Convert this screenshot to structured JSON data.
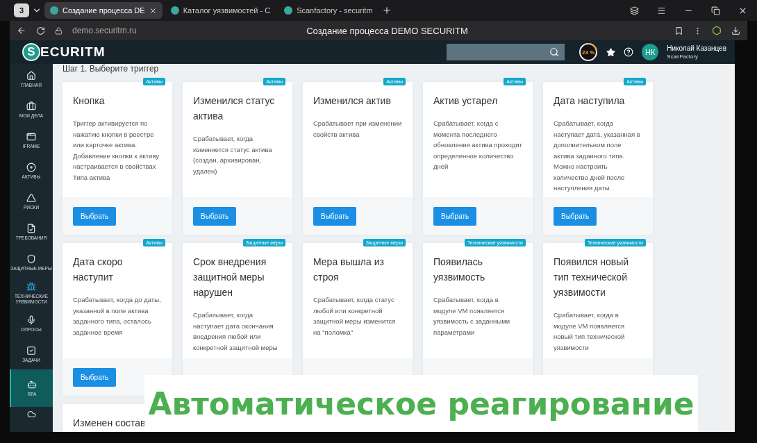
{
  "browser": {
    "tab_count": "3",
    "tabs": [
      {
        "title": "Создание процесса DE",
        "selected": true
      },
      {
        "title": "Каталог уязвимостей - C",
        "selected": false
      },
      {
        "title": "Scanfactory - securitm",
        "selected": false
      }
    ],
    "url": "demo.securitm.ru",
    "page_title": "Создание процесса DEMO SECURITM"
  },
  "header": {
    "logo_mark": "S",
    "logo_text": "ECURITM",
    "progress": {
      "label": "23 %",
      "level": 0.23
    },
    "avatar": "НК",
    "user_name": "Николай Казанцев",
    "org": "ScanFactory"
  },
  "sidebar": {
    "items": [
      {
        "label": "ГЛАВНАЯ",
        "selected": false
      },
      {
        "label": "МОИ ДЕЛА",
        "selected": false
      },
      {
        "label": "IFRAME",
        "selected": false
      },
      {
        "label": "АКТИВЫ",
        "selected": false
      },
      {
        "label": "РИСКИ",
        "selected": false
      },
      {
        "label": "ТРЕБОВАНИЯ",
        "selected": false
      },
      {
        "label": "ЗАЩИТНЫЕ МЕРЫ",
        "selected": false
      },
      {
        "label": "ТЕХНИЧЕСКИЕ УЯЗВИМОСТИ",
        "selected": false
      },
      {
        "label": "ОПРОСЫ",
        "selected": false
      },
      {
        "label": "ЗАДАЧИ",
        "selected": false
      },
      {
        "label": "RPA",
        "selected": true
      }
    ]
  },
  "heading": "Шаг 1. Выберите триггер",
  "cards": [
    {
      "badge": "Активы",
      "title": "Кнопка",
      "description": "Триггер активируется по нажатию кнопки в реестре или карточке актива. Добавление кнопки к активу настраивается в свойствах Типа актива",
      "button": "Выбрать"
    },
    {
      "badge": "Активы",
      "title": "Изменился статус актива",
      "description": "Срабатывает, когда изменяется статус актива (создан, архивирован, удален)",
      "button": "Выбрать"
    },
    {
      "badge": "Активы",
      "title": "Изменился актив",
      "description": "Срабатывает при изменении свойств актива",
      "button": "Выбрать"
    },
    {
      "badge": "Активы",
      "title": "Актив устарел",
      "description": "Срабатывает, когда с момента последнего обновления актива проходит определенное количество дней",
      "button": "Выбрать"
    },
    {
      "badge": "Активы",
      "title": "Дата наступила",
      "description": "Срабатывает, когда наступает дата, указанная в дополнительном поле актива заданного типа. Можно настроить количество дней после наступления даты.",
      "button": "Выбрать"
    },
    {
      "badge": "Активы",
      "title": "Дата скоро наступит",
      "description": "Срабатывает, когда до даты, указанной в поле актива заданного типа, осталось заданное время",
      "button": "Выбрать"
    },
    {
      "badge": "Защитные меры",
      "title": "Срок внедрения защитной меры нарушен",
      "description": "Срабатывает, когда наступает дата окончания внедрения любой или конкретной защитной меры"
    },
    {
      "badge": "Защитные меры",
      "title": "Мера вышла из строя",
      "description": "Срабатывает, когда статус любой или конкретной защитной меры изменится на \"поломка\""
    },
    {
      "badge": "Технические уязвимости",
      "title": "Появилась уязвимость",
      "description": "Срабатывает, когда в модуле VM появляется уязвимость с заданными параметрами"
    },
    {
      "badge": "Технические уязвимости",
      "title": "Появился новый тип технической уязвимости",
      "description": "Срабатывает, когда в модуле VM появляется новый тип технической уязвимости"
    },
    {
      "title": "Изменен состав"
    }
  ],
  "caption": "Автоматическое реагирование"
}
